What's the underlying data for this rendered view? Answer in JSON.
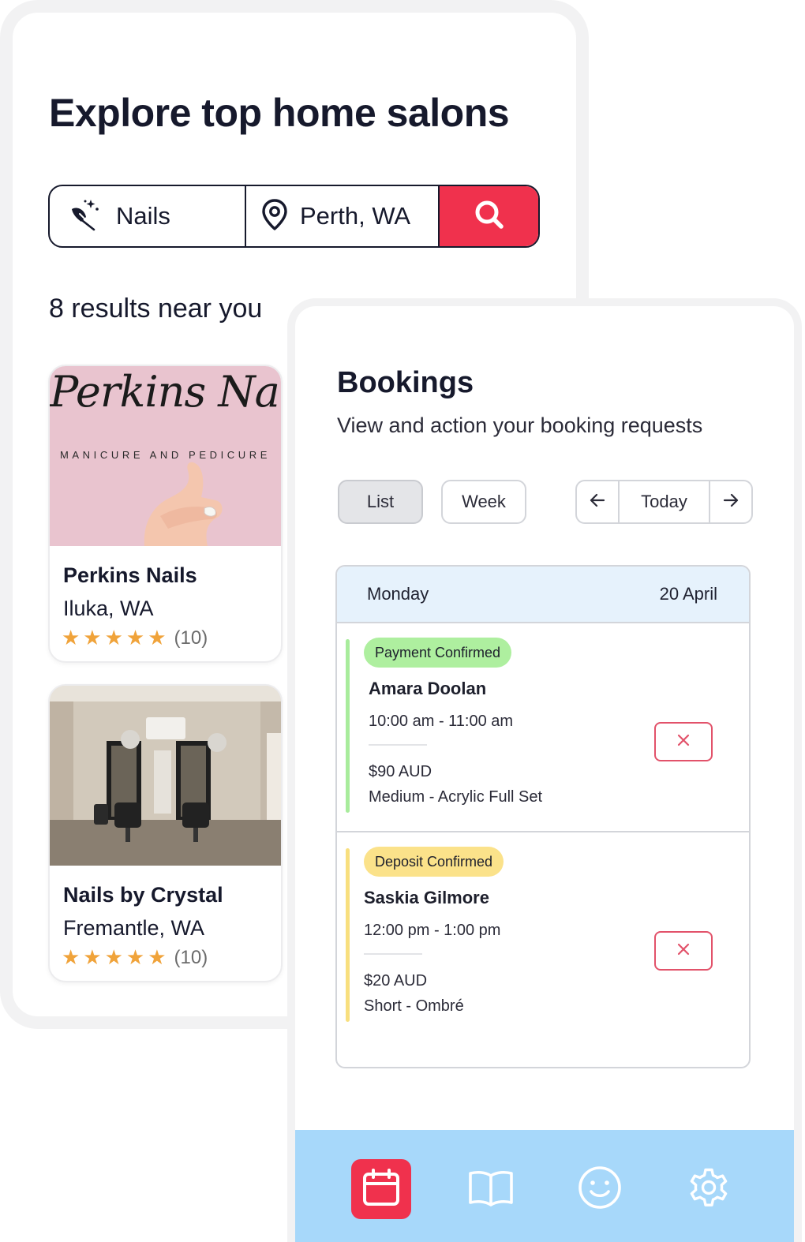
{
  "explore": {
    "title": "Explore top home salons",
    "search": {
      "service_value": "Nails",
      "location_value": "Perth, WA",
      "service_icon": "nail-polish-icon",
      "location_icon": "map-pin-icon",
      "search_icon": "search-icon"
    },
    "results_count": "8 results near you",
    "salons": [
      {
        "image_title": "Perkins Nails",
        "image_subtitle": "MANICURE AND PEDICURE",
        "name": "Perkins Nails",
        "location": "Iluka, WA",
        "stars": "★★★★★",
        "rating_count": "(10)"
      },
      {
        "name": "Nails by Crystal",
        "location": "Fremantle, WA",
        "stars": "★★★★★",
        "rating_count": "(10)"
      }
    ]
  },
  "bookings": {
    "title": "Bookings",
    "subtitle": "View and action your booking requests",
    "views": [
      "List",
      "Week"
    ],
    "active_view": "List",
    "date_nav": {
      "today": "Today"
    },
    "day": {
      "name": "Monday",
      "date": "20 April"
    },
    "items": [
      {
        "status": "Payment Confirmed",
        "client": "Amara Doolan",
        "time": "10:00 am - 11:00 am",
        "price": "$90 AUD",
        "service": "Medium - Acrylic Full Set"
      },
      {
        "status": "Deposit Confirmed",
        "client": "Saskia Gilmore",
        "time": "12:00 pm - 1:00 pm",
        "price": "$20 AUD",
        "service": "Short - Ombré"
      }
    ],
    "bottom_nav": [
      "calendar-icon",
      "book-icon",
      "smiley-icon",
      "gear-icon"
    ]
  },
  "colors": {
    "brand": "#f0314d",
    "nav_bar": "#a7d8fa",
    "payment_confirmed": "#aeef9f",
    "deposit_confirmed": "#fbe28a",
    "star": "#f0a33a",
    "day_header": "#e6f2fc"
  }
}
